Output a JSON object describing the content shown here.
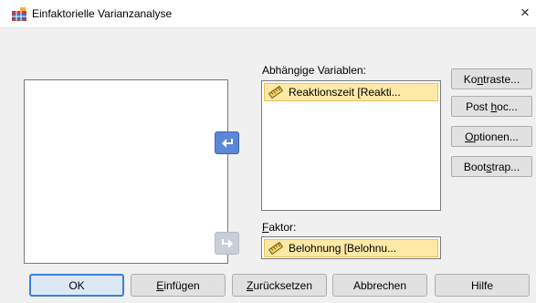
{
  "window": {
    "title": "Einfaktorielle Varianzanalyse",
    "close_glyph": "×",
    "app_icon": "spss-table-icon"
  },
  "panels": {
    "dependent": {
      "label_pre": "Abhängi",
      "label_accel": "g",
      "label_post": "e Variablen:",
      "items": [
        {
          "icon": "ruler-scale-icon",
          "text": "Reaktionszeit [Reakti..."
        }
      ]
    },
    "factor": {
      "label_accel": "F",
      "label_post": "aktor:",
      "item": {
        "icon": "ruler-scale-icon",
        "text": "Belohnung [Belohnu..."
      }
    }
  },
  "side_buttons": [
    {
      "pre": "Ko",
      "accel": "n",
      "post": "traste..."
    },
    {
      "pre": "Post ",
      "accel": "h",
      "post": "oc..."
    },
    {
      "pre": "",
      "accel": "O",
      "post": "ptionen..."
    },
    {
      "pre": "Boot",
      "accel": "s",
      "post": "trap..."
    }
  ],
  "bottom_buttons": [
    {
      "pre": "OK",
      "accel": "",
      "post": ""
    },
    {
      "pre": "",
      "accel": "E",
      "post": "infügen"
    },
    {
      "pre": "",
      "accel": "Z",
      "post": "urücksetzen"
    },
    {
      "pre": "Abbrechen",
      "accel": "",
      "post": ""
    },
    {
      "pre": "Hilfe",
      "accel": "",
      "post": ""
    }
  ],
  "colors": {
    "variable_highlight": "#ffe9a6",
    "arrow_active": "#5b88d6",
    "ok_border": "#3c7fd6"
  }
}
